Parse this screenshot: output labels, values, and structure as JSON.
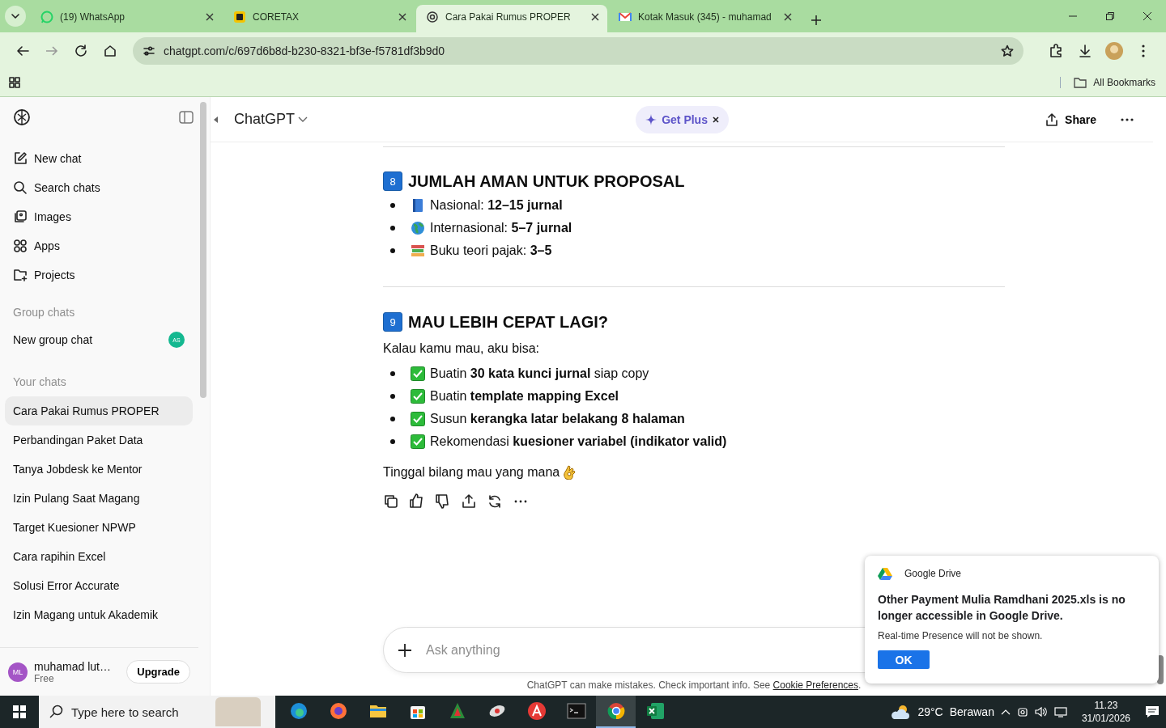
{
  "browser": {
    "tabs": [
      {
        "kind": "whatsapp",
        "title": "(19) WhatsApp",
        "selected": false
      },
      {
        "kind": "coretax",
        "title": "CORETAX",
        "selected": false
      },
      {
        "kind": "chatgpt",
        "title": "Cara Pakai Rumus PROPER",
        "selected": true
      },
      {
        "kind": "gmail",
        "title": "Kotak Masuk (345) - muhamad",
        "selected": false
      }
    ],
    "url": "chatgpt.com/c/697d6b8d-b230-8321-bf3e-f5781df3b9d0",
    "bookmarks_label": "All Bookmarks"
  },
  "sidebar": {
    "nav": [
      {
        "kind": "new",
        "label": "New chat"
      },
      {
        "kind": "search",
        "label": "Search chats"
      },
      {
        "kind": "images",
        "label": "Images"
      },
      {
        "kind": "apps",
        "label": "Apps"
      },
      {
        "kind": "projects",
        "label": "Projects"
      }
    ],
    "group_heading": "Group chats",
    "group_chat": {
      "label": "New group chat",
      "avatar": "AS"
    },
    "chats_heading": "Your chats",
    "chats": [
      {
        "label": "Cara Pakai Rumus PROPER",
        "selected": true
      },
      {
        "label": "Perbandingan Paket Data",
        "selected": false
      },
      {
        "label": "Tanya Jobdesk ke Mentor",
        "selected": false
      },
      {
        "label": "Izin Pulang Saat Magang",
        "selected": false
      },
      {
        "label": "Target Kuesioner NPWP",
        "selected": false
      },
      {
        "label": "Cara rapihin Excel",
        "selected": false
      },
      {
        "label": "Solusi Error Accurate",
        "selected": false
      },
      {
        "label": "Izin Magang untuk Akademik",
        "selected": false
      }
    ],
    "user": {
      "initials": "ML",
      "name": "muhamad lut…",
      "plan": "Free",
      "upgrade": "Upgrade"
    }
  },
  "header": {
    "model": "ChatGPT",
    "promo": "Get Plus",
    "share": "Share"
  },
  "message": {
    "sections": [
      {
        "number": "8",
        "title": "JUMLAH AMAN UNTUK PROPOSAL",
        "bullets": [
          {
            "kind": "book",
            "text": "Nasional: **12–15 jurnal**"
          },
          {
            "kind": "globe",
            "text": "Internasional: **5–7 jurnal**"
          },
          {
            "kind": "books",
            "text": "Buku teori pajak: **3–5**"
          }
        ]
      },
      {
        "number": "9",
        "title": "MAU LEBIH CEPAT LAGI?",
        "intro": "Kalau kamu mau, aku bisa:",
        "bullets": [
          {
            "kind": "check",
            "text": "Buatin **30 kata kunci jurnal** siap copy"
          },
          {
            "kind": "check",
            "text": "Buatin **template mapping Excel**"
          },
          {
            "kind": "check",
            "text": "Susun **kerangka latar belakang 8 halaman**"
          },
          {
            "kind": "check",
            "text": "Rekomendasi **kuesioner variabel (indikator valid)**"
          }
        ]
      }
    ],
    "closing": "Tinggal bilang mau yang mana"
  },
  "composer": {
    "placeholder": "Ask anything"
  },
  "disclaimer": {
    "text": "ChatGPT can make mistakes. Check important info. See",
    "link": "Cookie Preferences",
    "end": "."
  },
  "notification": {
    "app": "Google Drive",
    "title": "Other Payment Mulia Ramdhani 2025.xls is no longer accessible in Google Drive.",
    "body": "Real-time Presence will not be shown.",
    "button": "OK"
  },
  "taskbar": {
    "search_placeholder": "Type here to search",
    "apps": [
      {
        "kind": "edge",
        "selected": false
      },
      {
        "kind": "firefox",
        "selected": false
      },
      {
        "kind": "explorer",
        "selected": false
      },
      {
        "kind": "store",
        "selected": false
      },
      {
        "kind": "tree",
        "selected": false
      },
      {
        "kind": "satellite",
        "selected": false
      },
      {
        "kind": "triangle",
        "selected": false
      },
      {
        "kind": "terminal",
        "selected": false
      },
      {
        "kind": "chrome",
        "selected": true
      },
      {
        "kind": "excel",
        "selected": false
      }
    ],
    "weather": "29°C",
    "condition": "Berawan",
    "time": "11.23",
    "date": "31/01/2026"
  }
}
